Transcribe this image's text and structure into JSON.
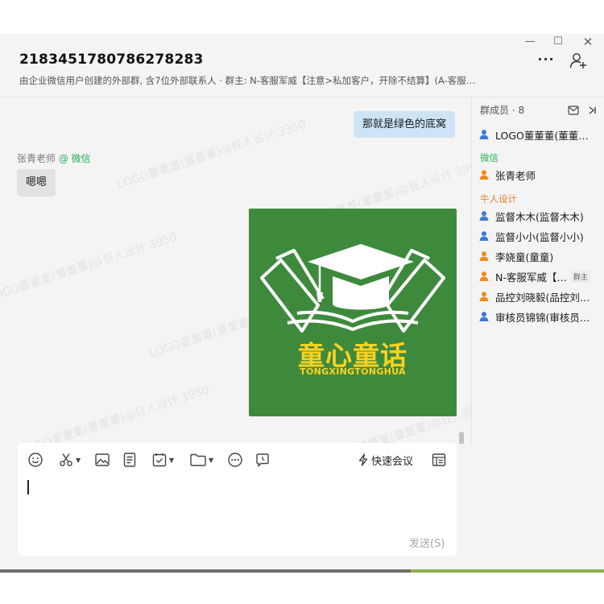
{
  "window": {
    "minimize_icon": "minimize-icon",
    "maximize_icon": "maximize-icon",
    "close_icon": "close-icon"
  },
  "header": {
    "title": "2183451780786278283",
    "subtitle": "由企业微信用户创建的外部群, 含7位外部联系人 · 群主: N-客服军威【注意>私加客户，开除不结算】(A-客服…",
    "more_icon": "more-icon",
    "add_member_icon": "add-member-icon"
  },
  "messages": {
    "self_message": "那就是绿色的底窝",
    "other_sender_name": "张青老师",
    "other_sender_source": "@ 微信",
    "other_message": "嗯嗯",
    "image": {
      "title_cn": "童心童话",
      "title_en": "TONGXINGTONGHUA",
      "background_color": "#3e8a3d",
      "text_color": "#ffd21f"
    },
    "watermark": "LOGO董董董(董董董)@狂人设计 3950"
  },
  "composer": {
    "tools": [
      "emoji-icon",
      "scissors-icon",
      "image-icon",
      "document-icon",
      "calendar-check-icon",
      "folder-icon",
      "more-circle-icon",
      "clock-message-icon"
    ],
    "quick_meeting_label": "快速会议",
    "send_label": "发送(S)"
  },
  "members": {
    "header": "群成员 · 8",
    "self_member": {
      "name": "LOGO董董董(董董…",
      "color": "#3a7bd5"
    },
    "groups": [
      {
        "label": "微信",
        "color": "#2eaa5a",
        "items": [
          {
            "name": "张青老师",
            "color": "#f08a1c"
          }
        ]
      },
      {
        "label": "牛人设计",
        "color": "#e8812a",
        "items": [
          {
            "name": "监督木木(监督木木)",
            "color": "#3a7bd5"
          },
          {
            "name": "监督小小(监督小小)",
            "color": "#3a7bd5"
          },
          {
            "name": "李娆童(童童)",
            "color": "#f08a1c"
          },
          {
            "name": "N-客服军威【…",
            "color": "#f08a1c",
            "tag": "群主"
          },
          {
            "name": "品控刘晓毅(品控刘…",
            "color": "#f08a1c"
          },
          {
            "name": "审核员锦锦(审核员…",
            "color": "#3a7bd5"
          }
        ]
      }
    ]
  }
}
